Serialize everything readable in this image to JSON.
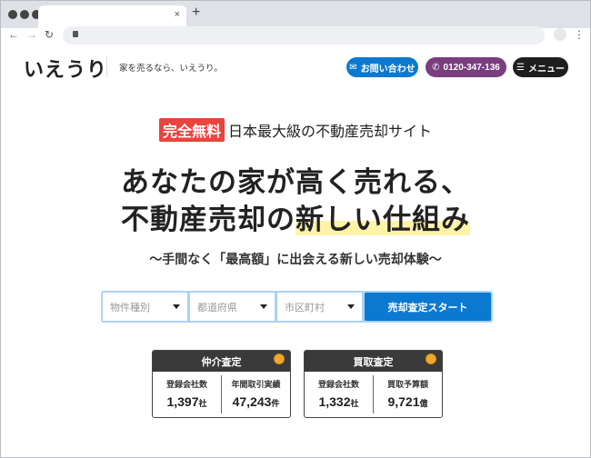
{
  "browser": {
    "close_tab": "×",
    "new_tab": "+",
    "back": "←",
    "forward": "→",
    "reload": "↻",
    "menu": "⋮"
  },
  "header": {
    "logo": "いえうり",
    "tagline": "家を売るなら、いえうり。",
    "contact_label": "お問い合わせ",
    "phone_label": "0120-347-136",
    "menu_label": "メニュー",
    "colors": {
      "contact": "#0b79d0",
      "phone": "#7a3d7e",
      "menu": "#1e1e1e"
    }
  },
  "hero": {
    "badge": "完全無料",
    "badge_text": "日本最大級の不動産売却サイト",
    "headline_line1": "あなたの家が高く売れる、",
    "headline_line2_a": "不動産売却の",
    "headline_line2_b": "新しい仕組み",
    "subtitle": "〜手間なく「最高額」に出会える新しい売却体験〜"
  },
  "search": {
    "property_type": "物件種別",
    "prefecture": "都道府県",
    "city": "市区町村",
    "submit": "売却査定スタート"
  },
  "cards": [
    {
      "title": "仲介査定",
      "stats": [
        {
          "label": "登録会社数",
          "value": "1,397",
          "unit": "社"
        },
        {
          "label": "年間取引実績",
          "value": "47,243",
          "unit": "件"
        }
      ]
    },
    {
      "title": "買取査定",
      "stats": [
        {
          "label": "登録会社数",
          "value": "1,332",
          "unit": "社"
        },
        {
          "label": "買取予算額",
          "value": "9,721",
          "unit": "億"
        }
      ]
    }
  ]
}
